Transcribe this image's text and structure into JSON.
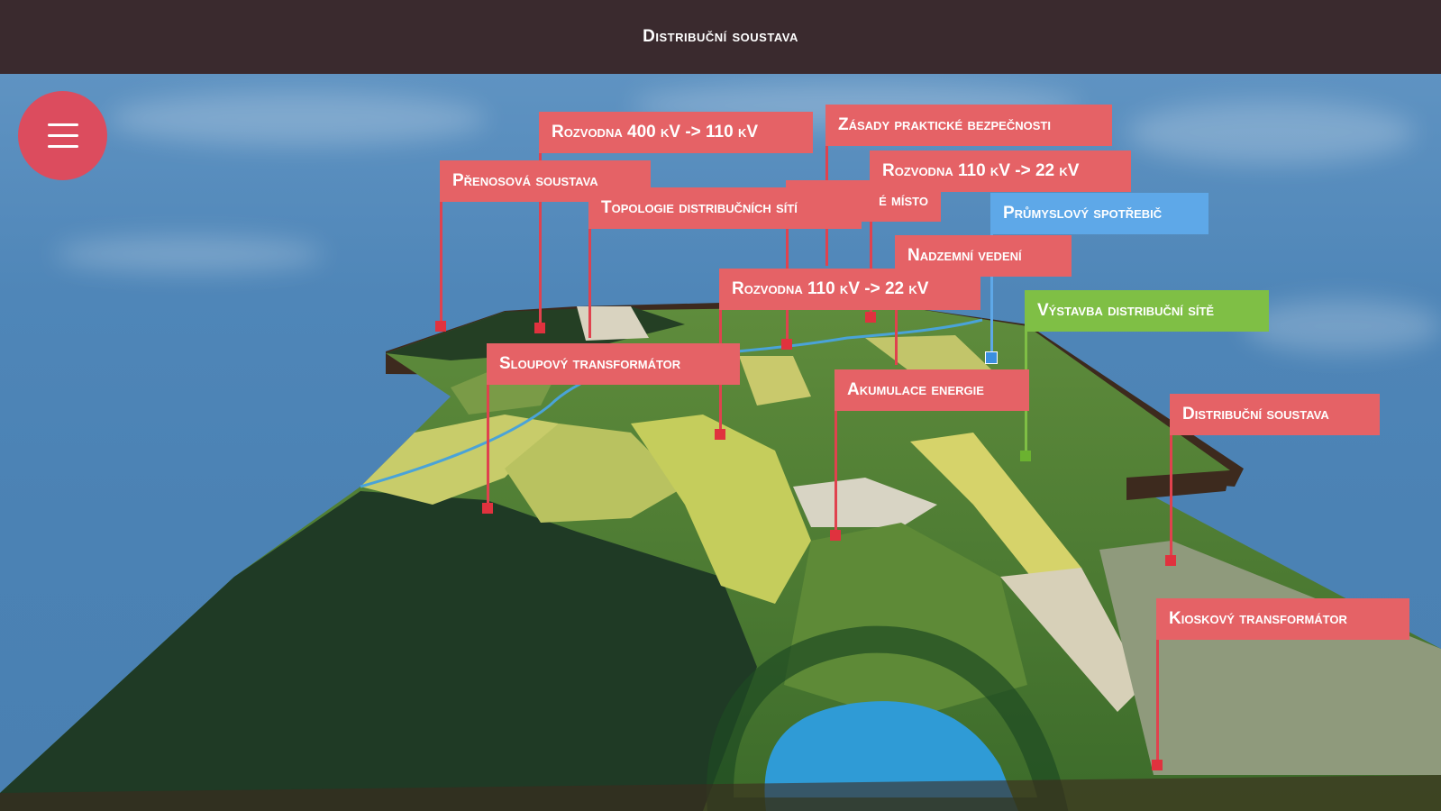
{
  "header": {
    "title": "Distribuční soustava"
  },
  "menu": {
    "icon": "hamburger-menu-icon"
  },
  "colors": {
    "header_bg": "#3a2a2e",
    "label_red": "#e56266",
    "label_blue": "#5ea8e8",
    "label_green": "#7fbf45",
    "menu_button": "#dc4c5e"
  },
  "hotspots": {
    "rozvodna_400": "Rozvodna 400 kV -> 110 kV",
    "zasady": "Zásady praktické bezpečnosti",
    "prenosova": "Přenosová soustava",
    "rozvodna_110_top": "Rozvodna 110 kV -> 22 kV",
    "predavaci": "é místo",
    "topologie": "Topologie distribučních sítí",
    "prumyslovy": "Průmyslový spotřebič",
    "nadzemni": "Nadzemní vedení",
    "rozvodna_110_mid": "Rozvodna 110 kV -> 22 kV",
    "vystavba": "Výstavba distribuční sítě",
    "sloupovy": "Sloupový transformátor",
    "akumulace": "Akumulace energie",
    "distribucni": "Distribuční soustava",
    "kioskovy": "Kioskový transformátor"
  }
}
